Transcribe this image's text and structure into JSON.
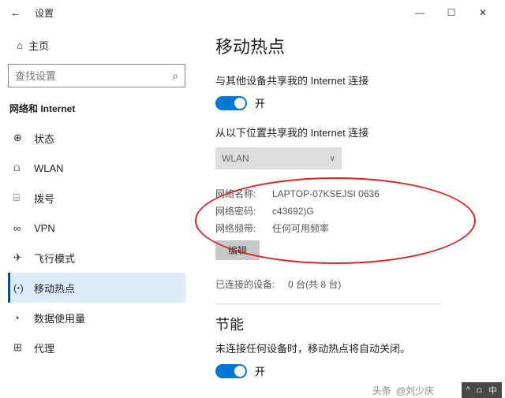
{
  "window": {
    "title": "设置",
    "min": "—",
    "max": "☐",
    "close": "✕",
    "back": "←"
  },
  "sidebar": {
    "home": "主页",
    "search_placeholder": "查找设置",
    "section": "网络和 Internet",
    "items": [
      {
        "label": "状态",
        "icon": "⊕"
      },
      {
        "label": "WLAN",
        "icon": "⩍"
      },
      {
        "label": "拨号",
        "icon": "⌸"
      },
      {
        "label": "VPN",
        "icon": "∞"
      },
      {
        "label": "飞行模式",
        "icon": "✈"
      },
      {
        "label": "移动热点",
        "icon": "(ꞏ)"
      },
      {
        "label": "数据使用量",
        "icon": "◔"
      },
      {
        "label": "代理",
        "icon": "⊞"
      }
    ]
  },
  "main": {
    "title": "移动热点",
    "share_label": "与其他设备共享我的 Internet 连接",
    "toggle1": "开",
    "from_label": "从以下位置共享我的 Internet 连接",
    "dropdown": "WLAN",
    "info": {
      "name_k": "网络名称:",
      "name_v": "LAPTOP-07KSEJSI 0636",
      "pwd_k": "网络密码:",
      "pwd_v": "c43692)G",
      "band_k": "网络频带:",
      "band_v": "任何可用频率",
      "edit": "编辑"
    },
    "connected_k": "已连接的设备:",
    "connected_v": "0 台(共 8 台)",
    "section2": "节能",
    "section2_desc": "未连接任何设备时，移动热点将自动关闭。",
    "toggle2": "开"
  },
  "watermark": {
    "source": "头条",
    "author": "@刘少庆"
  },
  "taskbar": {
    "ime": "中",
    "wifi": "⩍",
    "up": "^"
  }
}
